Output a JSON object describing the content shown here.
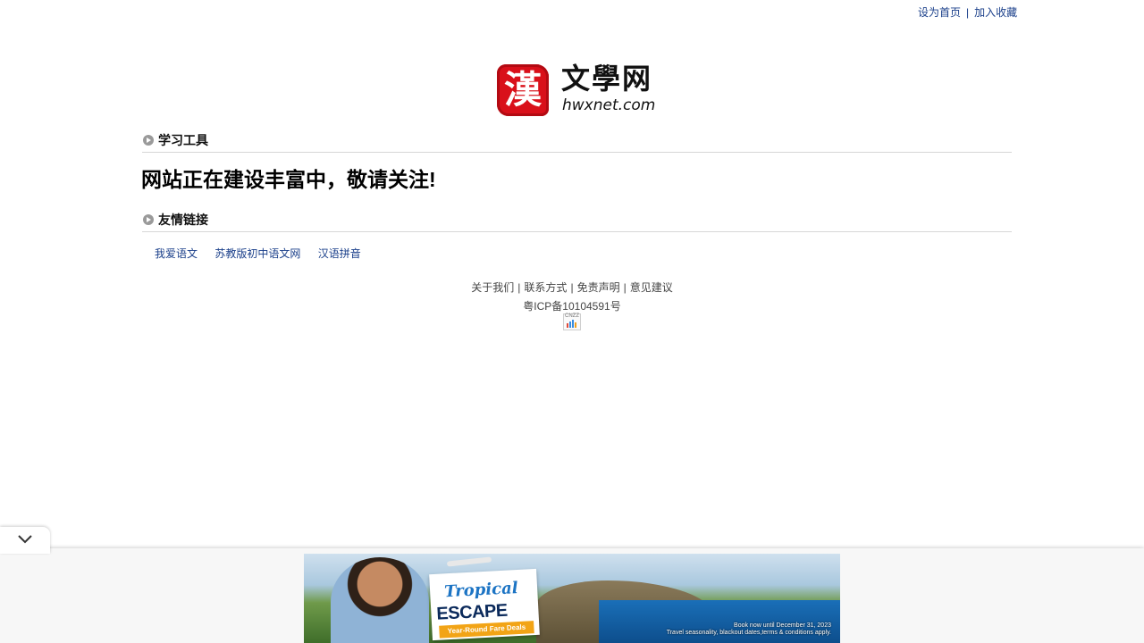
{
  "top_links": {
    "set_home": "设为首页",
    "separator": "|",
    "add_favorite": "加入收藏"
  },
  "logo": {
    "seal_char": "漢",
    "name_cn": "文學网",
    "domain": "hwxnet.com"
  },
  "sections": {
    "tools_title": "学习工具",
    "notice": "网站正在建设丰富中，敬请关注!",
    "links_title": "友情链接"
  },
  "friend_links": [
    "我爱语文",
    "苏教版初中语文网",
    "汉语拼音"
  ],
  "footer": {
    "links": [
      "关于我们",
      "联系方式",
      "免责声明",
      "意见建议"
    ],
    "separator": "|",
    "icp": "粤ICP备10104591号",
    "cnzz_label": "CNZZ"
  },
  "ad": {
    "headline1": "Tropical",
    "headline2": "ESCAPE",
    "tagline": "Year-Round Fare Deals",
    "note1": "Book now until December 31, 2023",
    "note2": "Travel seasonality, blackout dates,terms & conditions apply."
  },
  "colors": {
    "link": "#1a3f8a",
    "seal_red": "#d9101a"
  }
}
